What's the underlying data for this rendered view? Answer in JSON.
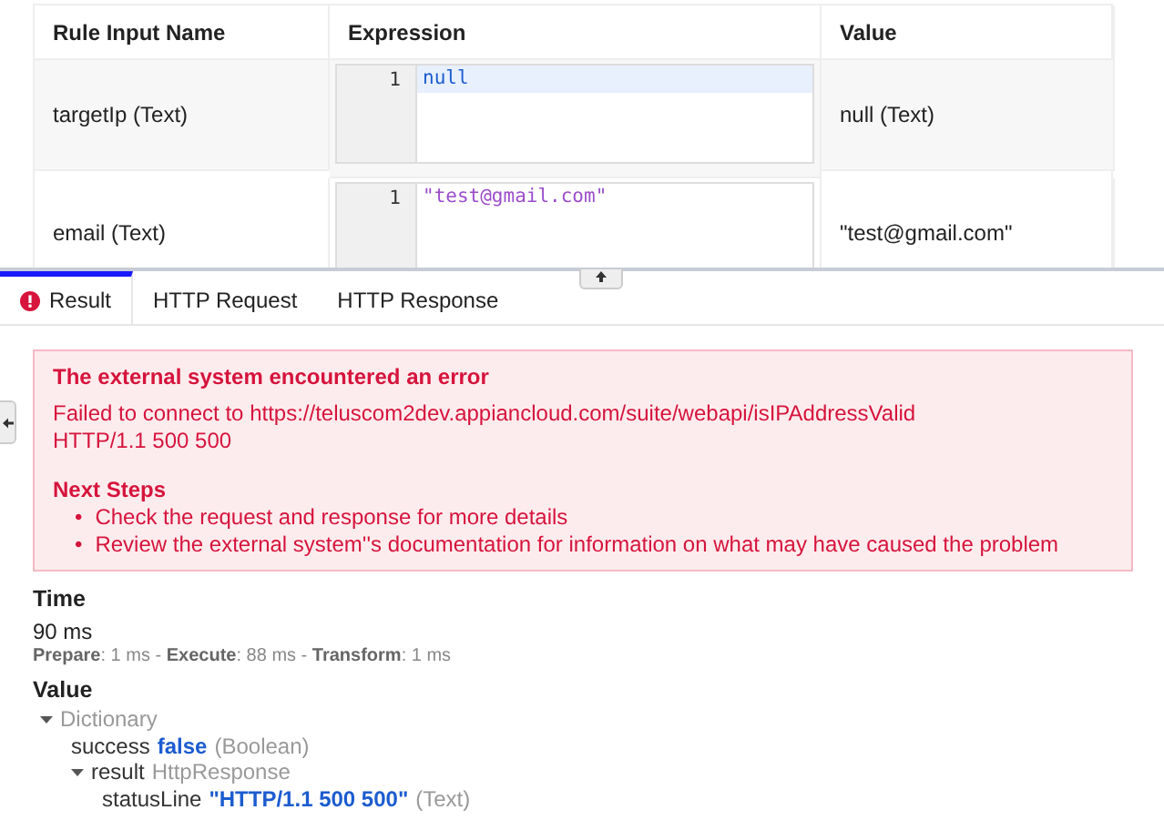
{
  "table": {
    "columns": [
      "Rule Input Name",
      "Expression",
      "Value"
    ],
    "rows": [
      {
        "name": "targetIp (Text)",
        "expression": {
          "line_number": "1",
          "code": "null",
          "kind": "keyword",
          "active": true
        },
        "value": "null (Text)"
      },
      {
        "name": "email (Text)",
        "expression": {
          "line_number": "1",
          "code": "\"test@gmail.com\"",
          "kind": "string",
          "active": false
        },
        "value": "\"test@gmail.com\""
      }
    ]
  },
  "tabs": [
    {
      "label": "Result",
      "selected": true,
      "alert": true
    },
    {
      "label": "HTTP Request",
      "selected": false,
      "alert": false
    },
    {
      "label": "HTTP Response",
      "selected": false,
      "alert": false
    }
  ],
  "error": {
    "title": "The external system encountered an error",
    "lines": [
      "Failed to connect to https://teluscom2dev.appiancloud.com/suite/webapi/isIPAddressValid",
      "HTTP/1.1 500 500"
    ],
    "next_steps_title": "Next Steps",
    "bullet": "•",
    "next_steps": [
      "Check the request and response for more details",
      "Review the external system''s documentation for information on what may have caused the problem"
    ]
  },
  "time": {
    "label": "Time",
    "value": "90 ms",
    "breakdown": "**Prepare**: 1 ms - **Execute**: 88 ms - **Transform**: 1 ms"
  },
  "value": {
    "label": "Value",
    "tree": [
      {
        "key": "Dictionary",
        "expanded": true,
        "children": [
          {
            "key": "success",
            "value": "false",
            "type": "(Boolean)"
          },
          {
            "key": "result",
            "type": "HttpResponse",
            "expanded": true,
            "children": [
              {
                "key": "statusLine",
                "value": "\"HTTP/1.1 500 500\"",
                "type": "(Text)"
              }
            ]
          }
        ]
      }
    ]
  }
}
